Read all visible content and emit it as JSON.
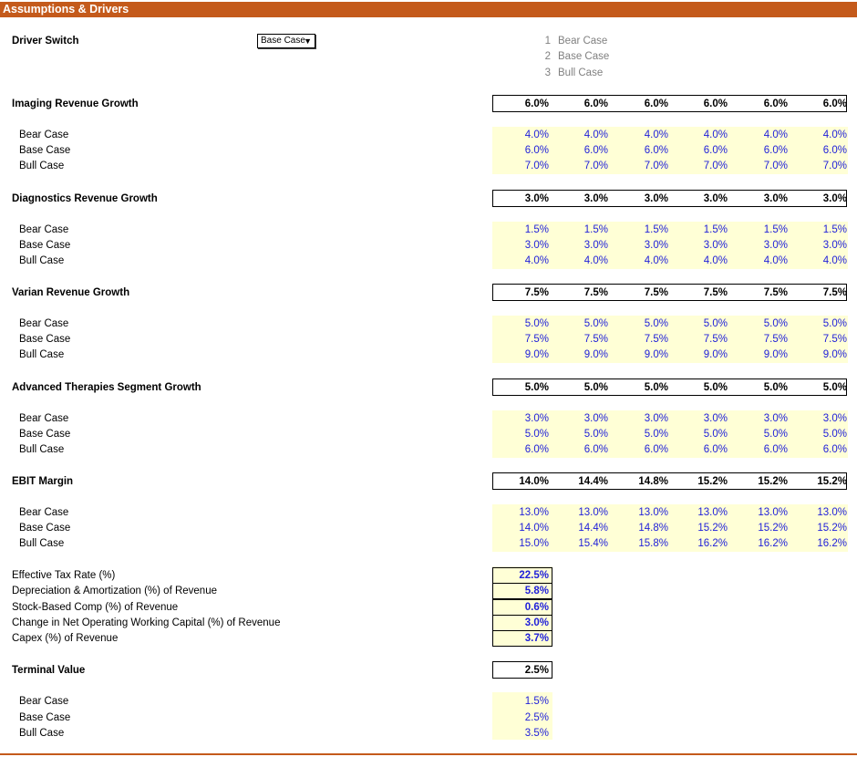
{
  "title": "Assumptions & Drivers",
  "driver_switch": {
    "label": "Driver Switch",
    "selected": "Base Case",
    "options": [
      {
        "num": "1",
        "label": "Bear Case"
      },
      {
        "num": "2",
        "label": "Base Case"
      },
      {
        "num": "3",
        "label": "Bull Case"
      }
    ]
  },
  "sections": [
    {
      "label": "Imaging Revenue Growth",
      "selected": [
        "6.0%",
        "6.0%",
        "6.0%",
        "6.0%",
        "6.0%",
        "6.0%"
      ],
      "cases": [
        {
          "label": "Bear Case",
          "values": [
            "4.0%",
            "4.0%",
            "4.0%",
            "4.0%",
            "4.0%",
            "4.0%"
          ]
        },
        {
          "label": "Base Case",
          "values": [
            "6.0%",
            "6.0%",
            "6.0%",
            "6.0%",
            "6.0%",
            "6.0%"
          ]
        },
        {
          "label": "Bull Case",
          "values": [
            "7.0%",
            "7.0%",
            "7.0%",
            "7.0%",
            "7.0%",
            "7.0%"
          ]
        }
      ]
    },
    {
      "label": "Diagnostics Revenue Growth",
      "selected": [
        "3.0%",
        "3.0%",
        "3.0%",
        "3.0%",
        "3.0%",
        "3.0%"
      ],
      "cases": [
        {
          "label": "Bear Case",
          "values": [
            "1.5%",
            "1.5%",
            "1.5%",
            "1.5%",
            "1.5%",
            "1.5%"
          ]
        },
        {
          "label": "Base Case",
          "values": [
            "3.0%",
            "3.0%",
            "3.0%",
            "3.0%",
            "3.0%",
            "3.0%"
          ]
        },
        {
          "label": "Bull Case",
          "values": [
            "4.0%",
            "4.0%",
            "4.0%",
            "4.0%",
            "4.0%",
            "4.0%"
          ]
        }
      ]
    },
    {
      "label": "Varian Revenue Growth",
      "selected": [
        "7.5%",
        "7.5%",
        "7.5%",
        "7.5%",
        "7.5%",
        "7.5%"
      ],
      "cases": [
        {
          "label": "Bear Case",
          "values": [
            "5.0%",
            "5.0%",
            "5.0%",
            "5.0%",
            "5.0%",
            "5.0%"
          ]
        },
        {
          "label": "Base Case",
          "values": [
            "7.5%",
            "7.5%",
            "7.5%",
            "7.5%",
            "7.5%",
            "7.5%"
          ]
        },
        {
          "label": "Bull Case",
          "values": [
            "9.0%",
            "9.0%",
            "9.0%",
            "9.0%",
            "9.0%",
            "9.0%"
          ]
        }
      ]
    },
    {
      "label": "Advanced Therapies Segment Growth",
      "selected": [
        "5.0%",
        "5.0%",
        "5.0%",
        "5.0%",
        "5.0%",
        "5.0%"
      ],
      "cases": [
        {
          "label": "Bear Case",
          "values": [
            "3.0%",
            "3.0%",
            "3.0%",
            "3.0%",
            "3.0%",
            "3.0%"
          ]
        },
        {
          "label": "Base Case",
          "values": [
            "5.0%",
            "5.0%",
            "5.0%",
            "5.0%",
            "5.0%",
            "5.0%"
          ]
        },
        {
          "label": "Bull Case",
          "values": [
            "6.0%",
            "6.0%",
            "6.0%",
            "6.0%",
            "6.0%",
            "6.0%"
          ]
        }
      ]
    },
    {
      "label": "EBIT Margin",
      "selected": [
        "14.0%",
        "14.4%",
        "14.8%",
        "15.2%",
        "15.2%",
        "15.2%"
      ],
      "cases": [
        {
          "label": "Bear Case",
          "values": [
            "13.0%",
            "13.0%",
            "13.0%",
            "13.0%",
            "13.0%",
            "13.0%"
          ]
        },
        {
          "label": "Base Case",
          "values": [
            "14.0%",
            "14.4%",
            "14.8%",
            "15.2%",
            "15.2%",
            "15.2%"
          ]
        },
        {
          "label": "Bull Case",
          "values": [
            "15.0%",
            "15.4%",
            "15.8%",
            "16.2%",
            "16.2%",
            "16.2%"
          ]
        }
      ]
    }
  ],
  "single_inputs": [
    {
      "label": "Effective Tax Rate (%)",
      "value": "22.5%"
    },
    {
      "label": "Depreciation & Amortization (%) of Revenue",
      "value": "5.8%"
    },
    {
      "label": "Stock-Based Comp (%) of Revenue",
      "value": "0.6%"
    },
    {
      "label": "Change in Net Operating Working Capital (%) of Revenue",
      "value": "3.0%"
    },
    {
      "label": "Capex (%) of Revenue",
      "value": "3.7%"
    }
  ],
  "terminal": {
    "label": "Terminal Value",
    "selected": "2.5%",
    "cases": [
      {
        "label": "Bear Case",
        "value": "1.5%"
      },
      {
        "label": "Base Case",
        "value": "2.5%"
      },
      {
        "label": "Bull Case",
        "value": "3.5%"
      }
    ]
  },
  "colors": {
    "banner": "#c45a1b",
    "input_fill": "#ffffd6",
    "input_text": "#2121d9"
  }
}
